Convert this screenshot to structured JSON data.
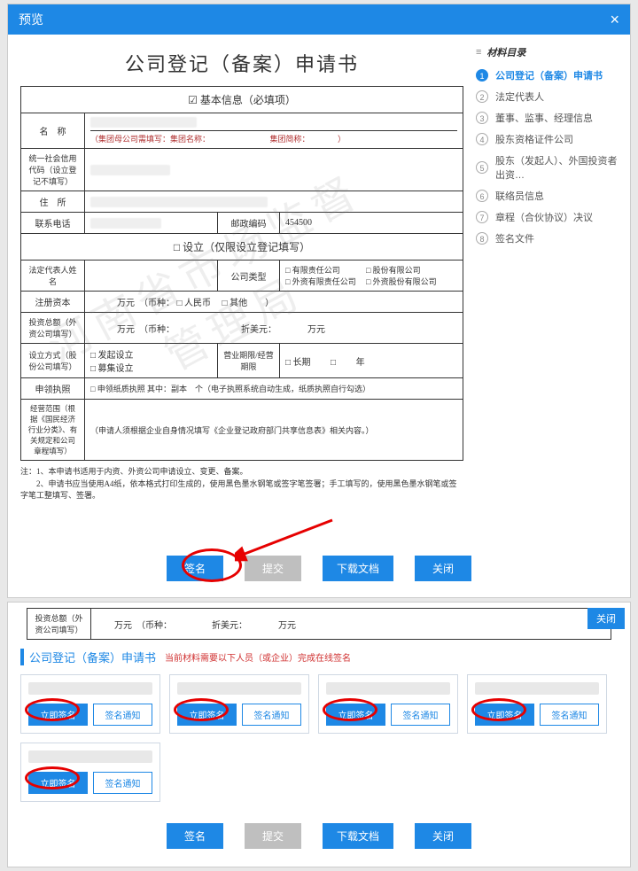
{
  "modal": {
    "title": "预览",
    "close": "×"
  },
  "doc": {
    "title": "公司登记（备案）申请书",
    "basic_header": "基本信息（必填项）",
    "name_label": "名　称",
    "group_note": "（集团母公司需填写：集团名称：　　　　　　　　集团简称：　　　　）",
    "uscc_label": "统一社会信用代码（设立登记不填写）",
    "addr_label": "住　所",
    "phone_label": "联系电话",
    "postcode_label": "邮政编码",
    "postcode_value": "454500",
    "setup_header": "设立（仅限设立登记填写）",
    "legal_label": "法定代表人姓名",
    "comp_type_label": "公司类型",
    "ct_opt1": "有限责任公司",
    "ct_opt2": "股份有限公司",
    "ct_opt3": "外资有限责任公司",
    "ct_opt4": "外资股份有限公司",
    "regcap_label": "注册资本",
    "regcap_text": "万元　（币种：",
    "cur_rmb": "人民币",
    "cur_other": "其他",
    "invtot_label": "投资总额（外资公司填写）",
    "invtot_text": "万元　（币种：　　　　　　　　折美元：　　　　万元",
    "mode_label": "设立方式（股份公司填写）",
    "mode_opt1": "发起设立",
    "mode_opt2": "募集设立",
    "term_label": "营业期限/经营期限",
    "term_opt1": "长期",
    "term_year": "年",
    "license_label": "申领执照",
    "license_text": "申领纸质执照 其中：副本　个（电子执照系统自动生成，纸质执照自行勾选）",
    "scope_label": "经营范围（根据《国民经济行业分类》、有关规定和公司章程填写）",
    "scope_text": "（申请人须根据企业自身情况填写《企业登记政府部门共享信息表》相关内容。）",
    "foot1": "注：1、本申请书适用于内资、外资公司申请设立、变更、备案。",
    "foot2": "　　2、申请书应当使用A4纸，依本格式打印生成的，使用黑色墨水钢笔或签字笔签署；手工填写的，使用黑色墨水钢笔或签字笔工整填写、签署。",
    "watermark": "河南省市场监督管理局"
  },
  "toc": {
    "header": "材料目录",
    "items": [
      {
        "n": "1",
        "label": "公司登记（备案）申请书",
        "active": true
      },
      {
        "n": "2",
        "label": "法定代表人"
      },
      {
        "n": "3",
        "label": "董事、监事、经理信息"
      },
      {
        "n": "4",
        "label": "股东资格证件公司"
      },
      {
        "n": "5",
        "label": "股东（发起人）、外国投资者出资…"
      },
      {
        "n": "6",
        "label": "联络员信息"
      },
      {
        "n": "7",
        "label": "章程（合伙协议）决议"
      },
      {
        "n": "8",
        "label": "签名文件"
      }
    ]
  },
  "buttons": {
    "sign": "签名",
    "submit": "提交",
    "download": "下载文档",
    "close": "关闭"
  },
  "panel2": {
    "inv_label": "投资总额（外资公司填写）",
    "inv_text": "万元　（币种：　　　　　折美元：　　　　万元",
    "close": "关闭",
    "section_title": "公司登记（备案）申请书",
    "section_sub": "当前材料需要以下人员（或企业）完成在线签名",
    "sign_now": "立即签名",
    "sign_notice": "签名通知"
  }
}
